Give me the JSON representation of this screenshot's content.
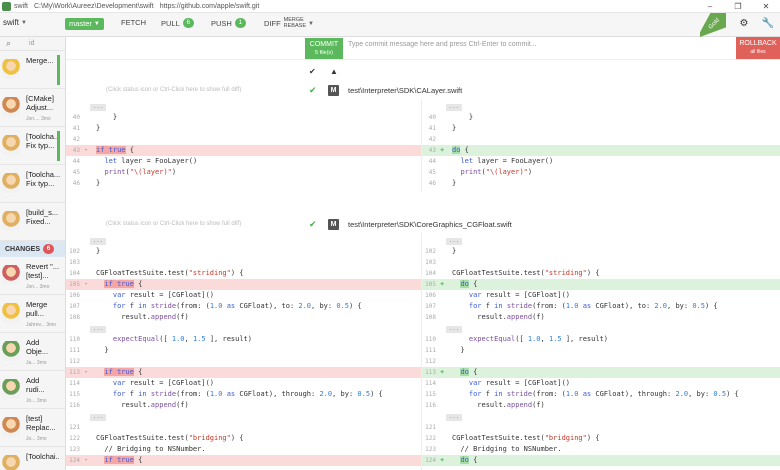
{
  "titlebar": {
    "app": "swift",
    "path": "C:\\My\\Work\\Aureez\\Development\\swift",
    "url": "https://github.com/apple/swift.git",
    "win_minimize": "–",
    "win_restore": "❐",
    "win_close": "✕"
  },
  "toolbar": {
    "repo": "swift",
    "branch": "master",
    "fetch": "FETCH",
    "pull": "PULL",
    "pull_count": "6",
    "push": "PUSH",
    "push_count": "1",
    "diff": "DIFF",
    "merge_rebase": [
      "MERGE",
      "REBASE"
    ],
    "gold": "Gold"
  },
  "sidebar": {
    "search_placeholder": "id",
    "commits": [
      {
        "title": "Merge...",
        "sub": "",
        "selected": true,
        "color": "#f0c040"
      },
      {
        "title": "[CMake] Adjust...",
        "sub": "Jon.... 3mo",
        "selected": false,
        "color": "#d08850"
      },
      {
        "title": "[Toolcha... Fix typ...",
        "sub": "",
        "selected": true,
        "color": "#e0b060"
      },
      {
        "title": "[Toolcha... Fix typ...",
        "sub": "",
        "selected": false,
        "color": "#e0b060"
      },
      {
        "title": "[build_s... Fixed...",
        "sub": "",
        "selected": false,
        "color": "#e0b060"
      }
    ],
    "changes_label": "CHANGES",
    "changes_count": "6",
    "changes": [
      {
        "title": "Revert \"... [test]...",
        "sub": "Jon... 3mo",
        "selected": false,
        "color": "#d06060"
      },
      {
        "title": "Merge pull...",
        "sub": "Jahrev... 3mo",
        "selected": false,
        "color": "#f0c040"
      },
      {
        "title": "Add Obje...",
        "sub": "Ja... 3mo",
        "selected": false,
        "color": "#6a9f5a"
      },
      {
        "title": "Add rudi...",
        "sub": "Jo... 3mo",
        "selected": false,
        "color": "#6a9f5a"
      },
      {
        "title": "[test] Replac...",
        "sub": "Jo... 3mo",
        "selected": false,
        "color": "#d08850"
      },
      {
        "title": "[Toolchai...",
        "sub": "",
        "selected": false,
        "color": "#e0b060"
      }
    ]
  },
  "commitbar": {
    "commit": "COMMIT",
    "commit_sub": "5 file(s)",
    "placeholder": "Type commit message here and press Ctrl-Enter to commit...",
    "rollback": "ROLLBACK",
    "rollback_sub": "all files"
  },
  "files": [
    {
      "hint": "(Click status icon or Ctrl-Click here to show full diff)",
      "path": "test\\Interpreter\\SDK\\CALayer.swift",
      "status": "M"
    },
    {
      "hint": "(Click status icon or Ctrl-Click here to show full diff)",
      "path": "test\\Interpreter\\SDK\\CoreGraphics_CGFloat.swift",
      "status": "M"
    }
  ],
  "diff1": {
    "left": [
      {
        "t": "ellip",
        "ln": "",
        "c": ""
      },
      {
        "t": "ctx",
        "ln": "40",
        "c": "    }"
      },
      {
        "t": "ctx",
        "ln": "41",
        "c": "}"
      },
      {
        "t": "ctx",
        "ln": "42",
        "c": ""
      },
      {
        "t": "del",
        "ln": "43",
        "c": "if true {",
        "mk": "-"
      },
      {
        "t": "ctx",
        "ln": "44",
        "c": "  let layer = FooLayer()"
      },
      {
        "t": "ctx",
        "ln": "45",
        "c": "  print(\"\\(layer)\")"
      },
      {
        "t": "ctx",
        "ln": "46",
        "c": "}"
      }
    ],
    "right": [
      {
        "t": "ellip",
        "ln": "",
        "c": ""
      },
      {
        "t": "ctx",
        "ln": "40",
        "c": "    }"
      },
      {
        "t": "ctx",
        "ln": "41",
        "c": "}"
      },
      {
        "t": "ctx",
        "ln": "42",
        "c": ""
      },
      {
        "t": "add",
        "ln": "43",
        "c": "do {",
        "mk": "+"
      },
      {
        "t": "ctx",
        "ln": "44",
        "c": "  let layer = FooLayer()"
      },
      {
        "t": "ctx",
        "ln": "45",
        "c": "  print(\"\\(layer)\")"
      },
      {
        "t": "ctx",
        "ln": "46",
        "c": "}"
      }
    ]
  },
  "diff2": {
    "left": [
      {
        "t": "ellip",
        "ln": "",
        "c": ""
      },
      {
        "t": "ctx",
        "ln": "102",
        "c": "}"
      },
      {
        "t": "ctx",
        "ln": "103",
        "c": ""
      },
      {
        "t": "ctx",
        "ln": "104",
        "c": "CGFloatTestSuite.test(\"striding\") {"
      },
      {
        "t": "del",
        "ln": "105",
        "c": "  if true {",
        "mk": "-"
      },
      {
        "t": "ctx",
        "ln": "106",
        "c": "    var result = [CGFloat]()"
      },
      {
        "t": "ctx",
        "ln": "107",
        "c": "    for f in stride(from: (1.0 as CGFloat), to: 2.0, by: 0.5) {"
      },
      {
        "t": "ctx",
        "ln": "108",
        "c": "      result.append(f)"
      },
      {
        "t": "ellip",
        "ln": "",
        "c": ""
      },
      {
        "t": "ctx",
        "ln": "110",
        "c": "    expectEqual([ 1.0, 1.5 ], result)"
      },
      {
        "t": "ctx",
        "ln": "111",
        "c": "  }"
      },
      {
        "t": "ctx",
        "ln": "112",
        "c": ""
      },
      {
        "t": "del",
        "ln": "113",
        "c": "  if true {",
        "mk": "-"
      },
      {
        "t": "ctx",
        "ln": "114",
        "c": "    var result = [CGFloat]()"
      },
      {
        "t": "ctx",
        "ln": "115",
        "c": "    for f in stride(from: (1.0 as CGFloat), through: 2.0, by: 0.5) {"
      },
      {
        "t": "ctx",
        "ln": "116",
        "c": "      result.append(f)"
      },
      {
        "t": "ellip",
        "ln": "",
        "c": ""
      },
      {
        "t": "ctx",
        "ln": "121",
        "c": ""
      },
      {
        "t": "ctx",
        "ln": "122",
        "c": "CGFloatTestSuite.test(\"bridging\") {"
      },
      {
        "t": "ctx",
        "ln": "123",
        "c": "  // Bridging to NSNumber."
      },
      {
        "t": "del",
        "ln": "124",
        "c": "  if true {",
        "mk": "-"
      }
    ],
    "right": [
      {
        "t": "ellip",
        "ln": "",
        "c": ""
      },
      {
        "t": "ctx",
        "ln": "102",
        "c": "}"
      },
      {
        "t": "ctx",
        "ln": "103",
        "c": ""
      },
      {
        "t": "ctx",
        "ln": "104",
        "c": "CGFloatTestSuite.test(\"striding\") {"
      },
      {
        "t": "add",
        "ln": "105",
        "c": "  do {",
        "mk": "+"
      },
      {
        "t": "ctx",
        "ln": "106",
        "c": "    var result = [CGFloat]()"
      },
      {
        "t": "ctx",
        "ln": "107",
        "c": "    for f in stride(from: (1.0 as CGFloat), to: 2.0, by: 0.5) {"
      },
      {
        "t": "ctx",
        "ln": "108",
        "c": "      result.append(f)"
      },
      {
        "t": "ellip",
        "ln": "",
        "c": ""
      },
      {
        "t": "ctx",
        "ln": "110",
        "c": "    expectEqual([ 1.0, 1.5 ], result)"
      },
      {
        "t": "ctx",
        "ln": "111",
        "c": "  }"
      },
      {
        "t": "ctx",
        "ln": "112",
        "c": ""
      },
      {
        "t": "add",
        "ln": "113",
        "c": "  do {",
        "mk": "+"
      },
      {
        "t": "ctx",
        "ln": "114",
        "c": "    var result = [CGFloat]()"
      },
      {
        "t": "ctx",
        "ln": "115",
        "c": "    for f in stride(from: (1.0 as CGFloat), through: 2.0, by: 0.5) {"
      },
      {
        "t": "ctx",
        "ln": "116",
        "c": "      result.append(f)"
      },
      {
        "t": "ellip",
        "ln": "",
        "c": ""
      },
      {
        "t": "ctx",
        "ln": "121",
        "c": ""
      },
      {
        "t": "ctx",
        "ln": "122",
        "c": "CGFloatTestSuite.test(\"bridging\") {"
      },
      {
        "t": "ctx",
        "ln": "123",
        "c": "  // Bridging to NSNumber."
      },
      {
        "t": "add",
        "ln": "124",
        "c": "  do {",
        "mk": "+"
      }
    ]
  },
  "icons": {
    "search": "search-icon",
    "settings": "gear-icon",
    "tools": "wrench-icon"
  },
  "colors": {
    "accent_green": "#5cb85c",
    "rollback_red": "#e0605a",
    "deleted_bg": "#fbdada",
    "added_bg": "#ddf2dd"
  }
}
